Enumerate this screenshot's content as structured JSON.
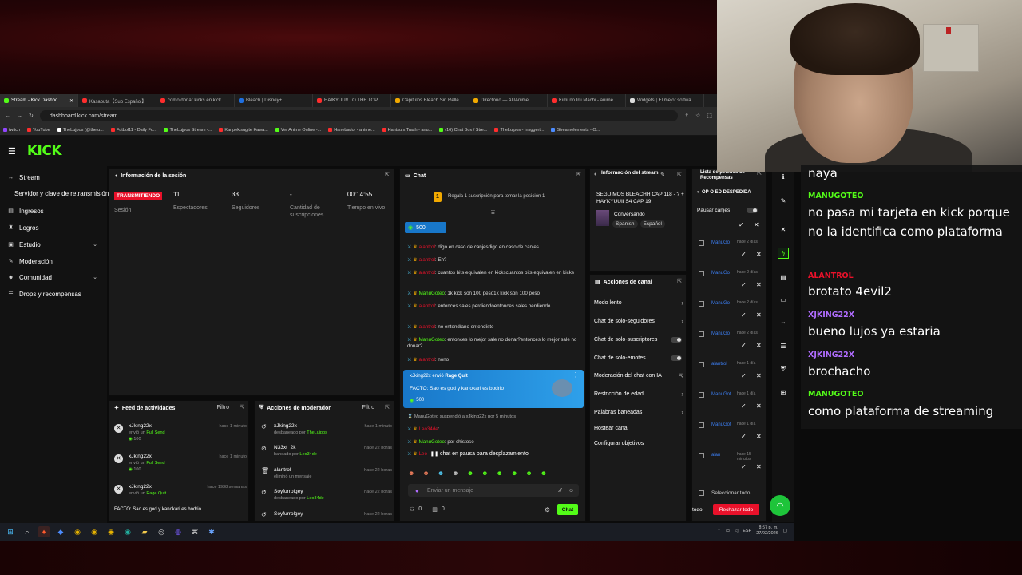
{
  "browser": {
    "tabs": [
      {
        "label": "Stream - Kick Dashbo",
        "color": "#53fc18",
        "active": true
      },
      {
        "label": "Kasabuta【Sub Español】",
        "color": "#ff2d2d"
      },
      {
        "label": "como donar kicks en kick",
        "color": "#ff2d2d"
      },
      {
        "label": "Bleach | Disney+",
        "color": "#1f6fe0"
      },
      {
        "label": "HAIKYUU!! TO THE TOP (tra",
        "color": "#ff2d2d"
      },
      {
        "label": "Capitulos Bleach Sin Relle",
        "color": "#f2a900"
      },
      {
        "label": "Directorio — AUAnime",
        "color": "#f2a900"
      },
      {
        "label": "Kimi no Iru Machi - anime",
        "color": "#ff2d2d"
      },
      {
        "label": "Widgets | El mejor softwa",
        "color": "#ddd"
      }
    ],
    "url": "dashboard.kick.com/stream",
    "bookmarks": [
      "twitch",
      "YouTube",
      "TheLujpos (@thelu...",
      "Futbol11 - Daily Fo...",
      "TheLujpos Stream -...",
      "Kanpekisugite Kawa...",
      "Ver Anime Online -...",
      "Hanebado! - anime...",
      "Hantsu x Trash - anu...",
      "(16) Chat Box / Stre...",
      "TheLujpos - Insggert...",
      "Streamelements - O..."
    ]
  },
  "sidebar": {
    "items": [
      {
        "icon": "stream-icon",
        "glyph": "↔",
        "label": "Stream"
      },
      {
        "icon": "key-icon",
        "glyph": "",
        "label": "Servidor y clave de retransmisión"
      },
      {
        "icon": "revenue-icon",
        "glyph": "▤",
        "label": "Ingresos"
      },
      {
        "icon": "trophy-icon",
        "glyph": "♜",
        "label": "Logros"
      },
      {
        "icon": "studio-icon",
        "glyph": "▣",
        "label": "Estudio"
      },
      {
        "icon": "wrench-icon",
        "glyph": "✎",
        "label": "Moderación"
      },
      {
        "icon": "community-icon",
        "glyph": "☻",
        "label": "Comunidad"
      },
      {
        "icon": "drops-icon",
        "glyph": "☰",
        "label": "Drops y recompensas"
      }
    ]
  },
  "session": {
    "title": "Información de la sesión",
    "live": "TRANSMITIENDO",
    "session_label": "Sesión",
    "viewers": "11",
    "viewers_label": "Espectadores",
    "followers": "33",
    "followers_label": "Seguidores",
    "subs": "-",
    "subs_label": "Cantidad de suscripciones",
    "time": "00:14:55",
    "time_label": "Tiempo en vivo"
  },
  "activity": {
    "title": "Feed de actividades",
    "filter": "Filtro",
    "rows": [
      {
        "name": "xJking22x",
        "action": "envió un",
        "item": "Full Send",
        "amount": "100",
        "time": "hace 1 minuto"
      },
      {
        "name": "xJking22x",
        "action": "envió un",
        "item": "Full Send",
        "amount": "100",
        "time": "hace 1 minuto"
      },
      {
        "name": "xJking22x",
        "action": "envió un",
        "item": "Rage Quit",
        "amount": "",
        "time": "hace 1938 semanas"
      }
    ],
    "last_msg": "FACTO: Sao es god y kanokari es bodrio"
  },
  "modactions": {
    "title": "Acciones de moderador",
    "filter": "Filtro",
    "rows": [
      {
        "name": "xJking22x",
        "action": "desbaneado por",
        "by": "TheLujpos",
        "time": "hace 1 minuto"
      },
      {
        "name": "N33xt_2k",
        "action": "baneado por",
        "by": "Leo34de",
        "time": "hace 22 horas"
      },
      {
        "name": "alantrol",
        "action": "eliminó un mensaje",
        "by": "",
        "time": "hace 22 horas"
      },
      {
        "name": "Soyfurrolgey",
        "action": "desbaneado por",
        "by": "Leo34de",
        "time": "hace 22 horas"
      },
      {
        "name": "Soyfurrolgey",
        "action": "",
        "by": "",
        "time": "hace 22 horas"
      }
    ]
  },
  "chat": {
    "title": "Chat",
    "pinned": "Regala 1 suscripción para tomar la posición 1",
    "pin_rank": "1",
    "kicks_badge": "500",
    "messages": [
      {
        "user": "alantrol",
        "text": "digo en caso de canjesdigo en caso de canjes",
        "color": "red"
      },
      {
        "user": "alantrol",
        "text": "Eh?",
        "color": "red"
      },
      {
        "user": "alantrol",
        "text": "cuantos bits equivalen en kickscuantos bits equivalen en kicks",
        "color": "red"
      },
      {
        "user": "ManuGoteo",
        "text": "1k kick son 100 peso1k kick son 100 peso",
        "color": "green"
      },
      {
        "user": "alantrol",
        "text": "entonces sales perdiendoentonces sales perdiendo",
        "color": "red"
      },
      {
        "user": "alantrol",
        "text": "no entendíano entendíste",
        "color": "red"
      },
      {
        "user": "ManuGoteo",
        "text": "entonces lo mejor sale no donar?entonces lo mejor sale no donar?",
        "color": "green"
      },
      {
        "user": "alantrol",
        "text": "nono",
        "color": "red"
      }
    ],
    "highlight": {
      "user": "xJking22x",
      "action": "envió",
      "item": "Rage Quit",
      "text": "FACTO: Sao es god y kanokari es bodrio",
      "amount": "500"
    },
    "after": [
      {
        "user": "ManuGoteo",
        "text": "suspendió a xJking22x por 5 minutos",
        "color": "gray"
      },
      {
        "user": "Leo34de",
        "text": "",
        "color": "red"
      },
      {
        "user": "ManuGoteo",
        "text": "por chistoso",
        "color": "green"
      },
      {
        "user": "Leo",
        "text": "chat en pausa para desplazamiento",
        "color": "red"
      }
    ],
    "input_placeholder": "Enviar un mensaje",
    "counter_a": "0",
    "counter_b": "0",
    "send": "Chat"
  },
  "streaminfo": {
    "title": "Información del stream",
    "stream_title": "SEGUIMOS BLEACHH CAP 118 - ? + HAYKYUUII S4 CAP 19",
    "category": "Conversando",
    "tags": [
      "Spanish",
      "Español"
    ]
  },
  "chanactions": {
    "title": "Acciones de canal",
    "items": [
      "Modo lento",
      "Chat de solo-seguidores",
      "Chat de solo-suscriptores",
      "Chat de solo-emotes",
      "Moderación del chat con IA",
      "Restricción de edad",
      "Palabras baneadas",
      "Hostear canal",
      "Configurar objetivos"
    ]
  },
  "rewards": {
    "title": "Lista de pedidos de Recompensas",
    "reward_name": "OP O ED DESPEDIDA",
    "pause": "Pausar canjes",
    "rows": [
      {
        "name": "ManuGo",
        "time": "hace 2 días"
      },
      {
        "name": "ManuGo",
        "time": "hace 2 días"
      },
      {
        "name": "ManuGo",
        "time": "hace 2 días"
      },
      {
        "name": "ManuGo",
        "time": "hace 2 días"
      },
      {
        "name": "alantrol",
        "time": "hace 1 día"
      },
      {
        "name": "ManuGot",
        "time": "hace 1 día"
      },
      {
        "name": "ManuGot",
        "time": "hace 1 día"
      },
      {
        "name": "alan",
        "time": "hace 15 minutos"
      }
    ],
    "select_all": "Seleccionar todo",
    "all": "todo",
    "reject": "Rechazar todo"
  },
  "overlay": {
    "top_partial": "naya",
    "entries": [
      {
        "user": "MANUGOTEO",
        "color": "#53fc18",
        "msg": "no pasa mi tarjeta en kick porque no la identifica como plataforma"
      },
      {
        "user": "ALANTROL",
        "color": "#e9112a",
        "msg": "brotato 4evil2"
      },
      {
        "user": "XJKING22X",
        "color": "#b06cff",
        "msg": "bueno lujos ya estaria"
      },
      {
        "user": "XJKING22X",
        "color": "#b06cff",
        "msg": "brochacho"
      },
      {
        "user": "MANUGOTEO",
        "color": "#53fc18",
        "msg": "como plataforma de streaming"
      }
    ]
  },
  "taskbar": {
    "time": "8:57 p. m.",
    "date": "27/02/2026",
    "lang": "ESP"
  }
}
